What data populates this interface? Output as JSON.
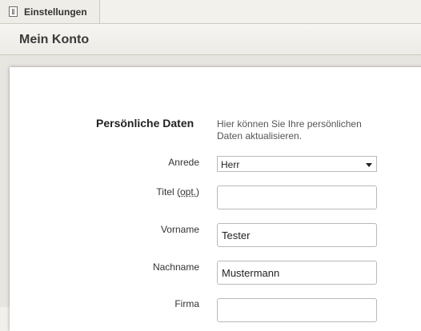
{
  "tab": {
    "label": "Einstellungen",
    "icon": "settings-tab-icon"
  },
  "header": {
    "title": "Mein Konto"
  },
  "section": {
    "title": "Persönliche Daten",
    "description": "Hier können Sie Ihre persönlichen Daten aktualisieren."
  },
  "form": {
    "anrede": {
      "label": "Anrede",
      "value": "Herr"
    },
    "titel": {
      "label_prefix": "Titel (",
      "label_abbr": "opt.",
      "label_suffix": ")",
      "value": ""
    },
    "vorname": {
      "label": "Vorname",
      "value": "Tester"
    },
    "nachname": {
      "label": "Nachname",
      "value": "Mustermann"
    },
    "firma": {
      "label": "Firma",
      "value": ""
    }
  }
}
